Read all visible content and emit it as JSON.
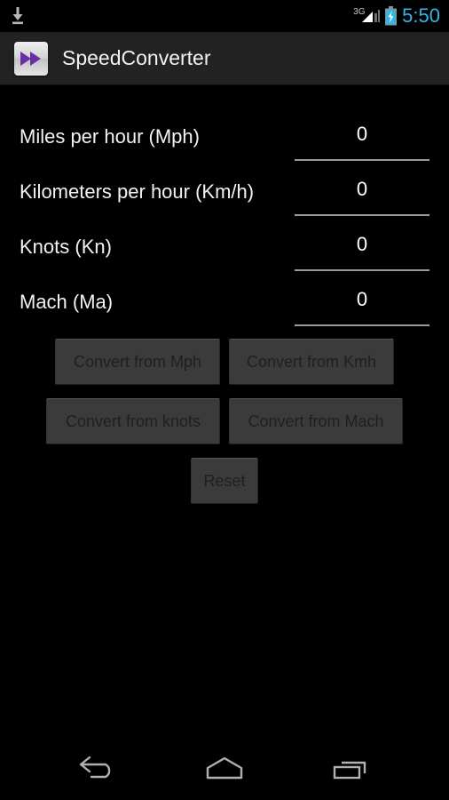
{
  "status_bar": {
    "download_icon": "download-icon",
    "network_label": "3G",
    "signal_icon": "signal-bars-icon",
    "battery_icon": "battery-charging-icon",
    "clock": "5:50",
    "clock_color": "#33b5e5"
  },
  "action_bar": {
    "app_icon": "fast-forward-icon",
    "title": "SpeedConverter",
    "background": "#222222",
    "icon_accent": "#6a2da8"
  },
  "fields": [
    {
      "label": "Miles per hour (Mph)",
      "value": "0",
      "name": "mph"
    },
    {
      "label": "Kilometers per hour (Km/h)",
      "value": "0",
      "name": "kmh"
    },
    {
      "label": "Knots (Kn)",
      "value": "0",
      "name": "knots"
    },
    {
      "label": "Mach (Ma)",
      "value": "0",
      "name": "mach"
    }
  ],
  "buttons": {
    "convert_mph": "Convert from Mph",
    "convert_kmh": "Convert from Kmh",
    "convert_knots": "Convert from knots",
    "convert_mach": "Convert from Mach",
    "reset": "Reset"
  },
  "nav_bar": {
    "back": "back-icon",
    "home": "home-icon",
    "recents": "recents-icon"
  }
}
